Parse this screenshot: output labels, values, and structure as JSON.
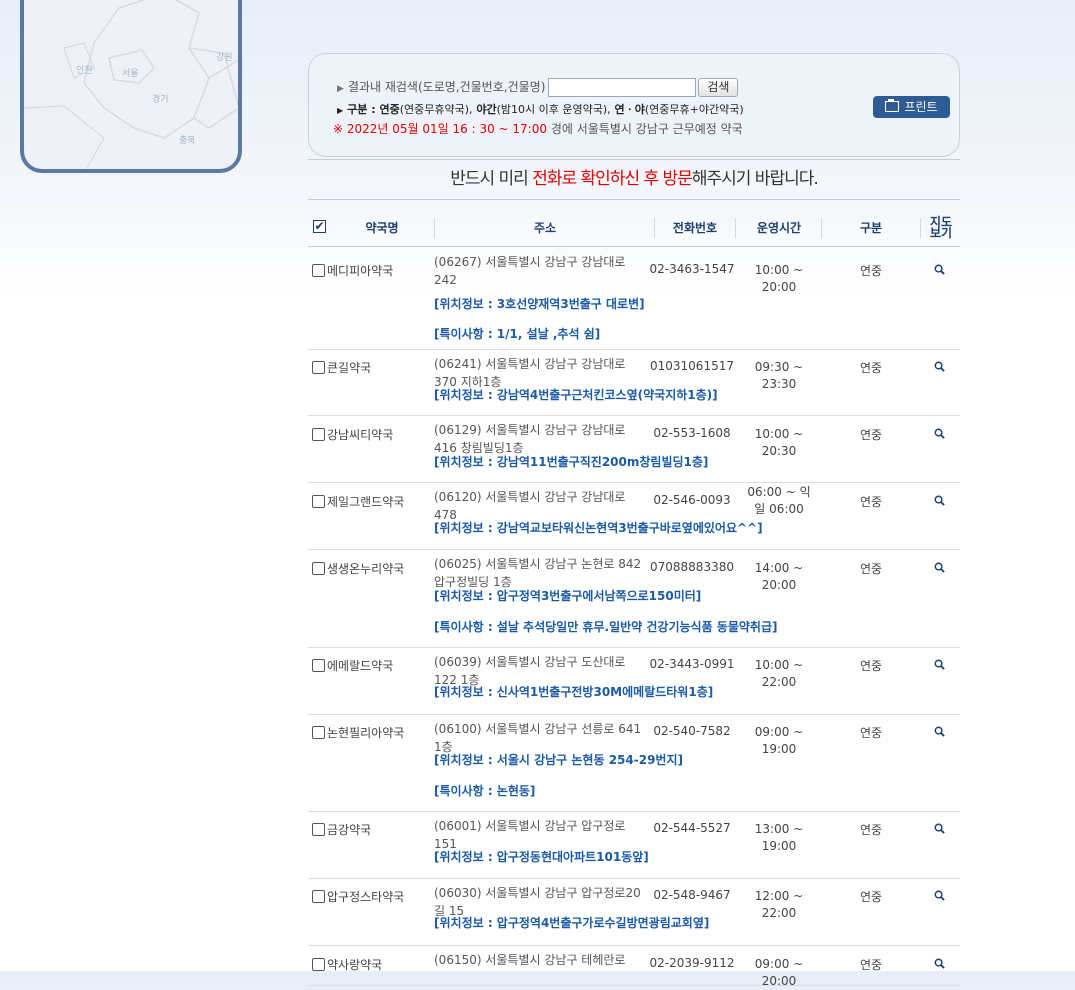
{
  "map": {
    "labels": [
      "인천",
      "서울",
      "경기",
      "강원",
      "충북"
    ]
  },
  "search": {
    "label": "결과내 재검색(도로명,건물번호,건물명)",
    "input_value": "",
    "button": "검색",
    "legend": {
      "prefix": "구분 :",
      "t1": "연중",
      "t1d": "(연중무휴약국),",
      "t2": "야간",
      "t2d": "(밤10시 이후 운영약국),",
      "t3": "연ㆍ야",
      "t3d": "(연중무휴+야간약국)"
    },
    "period": "※ 2022년 05월 01일 16 : 30 ~ 17:00",
    "period_suffix": "경에  서울특별시  강남구   근무예정  약국",
    "print_button": "프린트"
  },
  "notice": {
    "a": "반드시 미리 ",
    "b": "전화로 확인하신 후 방문",
    "c": "해주시기 바랍니다."
  },
  "table": {
    "headers": {
      "name": "약국명",
      "address": "주소",
      "phone": "전화번호",
      "hours": "운영시간",
      "type": "구분",
      "map": "지도보기"
    },
    "rows": [
      {
        "name": "메디피아약국",
        "address": "(06267) 서울특별시 강남구 강남대로 242",
        "phone": "02-3463-1547",
        "hours": "10:00 ~ 20:00",
        "type": "연중",
        "info": [
          "[위치정보 : 3호선양재역3번출구 대로변]",
          "[특이사항 : 1/1, 설날 ,추석 쉼]"
        ]
      },
      {
        "name": "큰길약국",
        "address": "(06241) 서울특별시 강남구 강남대로 370 지하1층",
        "phone": "01031061517",
        "hours": "09:30 ~ 23:30",
        "type": "연중",
        "info": [
          "[위치정보 : 강남역4번출구근처킨코스옆(약국지하1층)]"
        ]
      },
      {
        "name": "강남씨티약국",
        "address": "(06129) 서울특별시 강남구 강남대로 416 창림빌딩1층",
        "phone": "02-553-1608",
        "hours": "10:00 ~ 20:30",
        "type": "연중",
        "info": [
          "[위치정보 : 강남역11번출구직진200m창림빌딩1층]"
        ]
      },
      {
        "name": "제일그랜드약국",
        "address": "(06120) 서울특별시 강남구 강남대로 478",
        "phone": "02-546-0093",
        "hours": "06:00 ~ 익일 06:00",
        "type": "연중",
        "info": [
          "[위치정보 : 강남역교보타워신논현역3번출구바로옆에있어요^^]"
        ]
      },
      {
        "name": "생생온누리약국",
        "address": "(06025) 서울특별시 강남구 논현로 842 압구정빌딩 1층",
        "phone": "07088883380",
        "hours": "14:00 ~ 20:00",
        "type": "연중",
        "info": [
          "[위치정보 : 압구정역3번출구에서남쪽으로150미터]",
          "[특이사항 : 설날 추석당일만 휴무.일반약 건강기능식품 동물약취급]"
        ]
      },
      {
        "name": "에메랄드약국",
        "address": "(06039) 서울특별시 강남구 도산대로 122 1층",
        "phone": "02-3443-0991",
        "hours": "10:00 ~ 22:00",
        "type": "연중",
        "info": [
          "[위치정보 : 신사역1번출구전방30M에메랄드타워1층]"
        ]
      },
      {
        "name": "논현필리아약국",
        "address": "(06100) 서울특별시 강남구 선릉로 641 1층",
        "phone": "02-540-7582",
        "hours": "09:00 ~ 19:00",
        "type": "연중",
        "info": [
          "[위치정보 : 서울시 강남구 논현동 254-29번지]",
          "[특이사항 : 논현동]"
        ]
      },
      {
        "name": "금강약국",
        "address": "(06001) 서울특별시 강남구 압구정로 151",
        "phone": "02-544-5527",
        "hours": "13:00 ~ 19:00",
        "type": "연중",
        "info": [
          "[위치정보 : 압구정동현대아파트101동앞]"
        ]
      },
      {
        "name": "압구정스타약국",
        "address": "(06030) 서울특별시 강남구 압구정로20길 15",
        "phone": "02-548-9467",
        "hours": "12:00 ~ 22:00",
        "type": "연중",
        "info": [
          "[위치정보 : 압구정역4번출구가로수길방면광림교회옆]"
        ]
      },
      {
        "name": "약사랑약국",
        "address": "(06150) 서울특별시 강남구 테헤란로",
        "phone": "02-2039-9112",
        "hours": "09:00 ~ 20:00",
        "type": "연중",
        "info": []
      }
    ]
  }
}
